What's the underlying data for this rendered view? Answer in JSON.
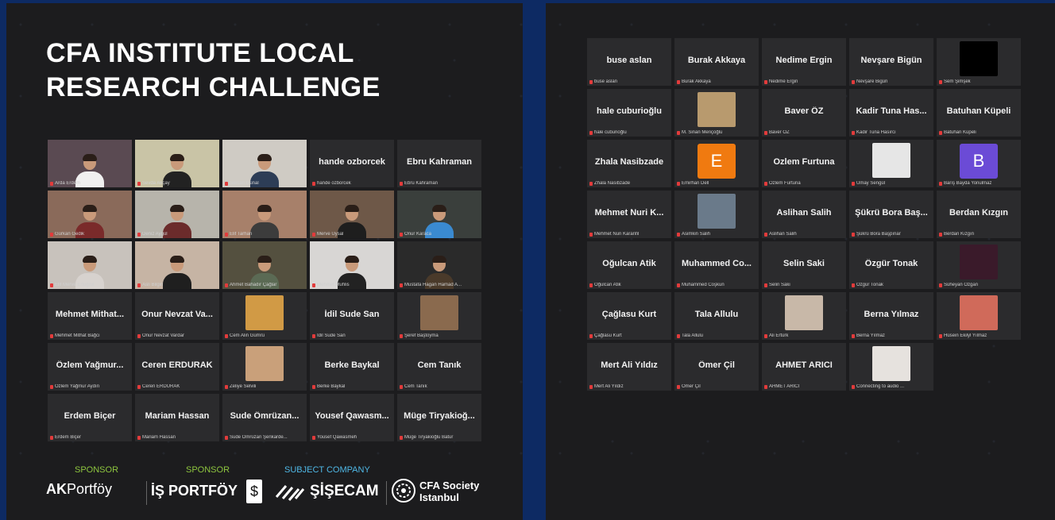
{
  "title_line1": "CFA INSTITUTE LOCAL",
  "title_line2": "RESEARCH CHALLENGE",
  "colors": {
    "background": "#0d2a63",
    "panel": "#1c1c1e",
    "tile": "#2b2b2d",
    "speaking": "#c7e16a",
    "sponsor": "#8ec63f",
    "subject": "#4fb8e6",
    "mic_muted": "#e23b3b"
  },
  "left_tiles": [
    {
      "type": "video",
      "small": "Arda Erdem",
      "bg": "#5a4a52",
      "shirt": "#f0f0f0"
    },
    {
      "type": "video",
      "small": "Sevda Akçay",
      "bg": "#c9c4a6",
      "shirt": "#222",
      "speaking": true
    },
    {
      "type": "video",
      "small": "Sercan Günal",
      "bg": "#cfcbc4",
      "shirt": "#2d3d56"
    },
    {
      "type": "name",
      "big": "hande ozborcek",
      "small": "hande ozborcek"
    },
    {
      "type": "name",
      "big": "Ebru Kahraman",
      "small": "Ebru Kahraman"
    },
    {
      "type": "video",
      "small": "Gürkan Gedik",
      "bg": "#8a6a5a",
      "shirt": "#7a2a2a"
    },
    {
      "type": "video",
      "small": "Deniz Aygül",
      "bg": "#b7b4ab",
      "shirt": "#6b2b2b"
    },
    {
      "type": "video",
      "small": "Elif Tarhan",
      "bg": "#a7806a",
      "shirt": "#3c3c3c"
    },
    {
      "type": "video",
      "small": "Merve Uysal",
      "bg": "#6e5848",
      "shirt": "#1e1e1e"
    },
    {
      "type": "video",
      "small": "Onur Karaca",
      "bg": "#3a3f3c",
      "shirt": "#3a8ad0"
    },
    {
      "type": "video",
      "small": "Elif Merve Ertuğrul",
      "bg": "#c8c2bc",
      "shirt": "#d7d2ce"
    },
    {
      "type": "video",
      "small": "Aslı Bilgin",
      "bg": "#c6b4a4",
      "shirt": "#1f1f1f"
    },
    {
      "type": "video",
      "small": "Ahmet Bahadır Çağlar",
      "bg": "#54503f",
      "shirt": "#5b6a54"
    },
    {
      "type": "video",
      "small": "Mehmet Muhlis",
      "bg": "#d8d6d4",
      "shirt": "#222"
    },
    {
      "type": "video",
      "small": "Mustafa Hagan Hamad A...",
      "bg": "#2a2a2a",
      "shirt": "#4a3a2a"
    },
    {
      "type": "name",
      "big": "Mehmet  Mithat...",
      "small": "Mehmet Mithat Bağcı"
    },
    {
      "type": "name",
      "big": "Onur Nevzat Va...",
      "small": "Onur Nevzat Vardar"
    },
    {
      "type": "thumb",
      "small": "Cem Alin Gümrü",
      "bg": "#d19a45"
    },
    {
      "type": "name",
      "big": "İdil Sude San",
      "small": "İdil Sude San"
    },
    {
      "type": "thumb",
      "small": "Şeref Baştoyma",
      "bg": "#8a6a4e"
    },
    {
      "type": "name",
      "big": "Özlem Yağmur...",
      "small": "Özlem Yağmur Aydın"
    },
    {
      "type": "name",
      "big": "Ceren ERDURAK",
      "small": "Ceren ERDURAK"
    },
    {
      "type": "thumb",
      "small": "Zeliye Selvili",
      "bg": "#c9a07a"
    },
    {
      "type": "name",
      "big": "Berke Baykal",
      "small": "Berke Baykal"
    },
    {
      "type": "name",
      "big": "Cem Tanık",
      "small": "Cem Tanık"
    },
    {
      "type": "name",
      "big": "Erdem Biçer",
      "small": "Erdem Biçer"
    },
    {
      "type": "name",
      "big": "Mariam Hassan",
      "small": "Mariam Hassan"
    },
    {
      "type": "name",
      "big": "Sude Ömrüzan...",
      "small": "Sude Ömrüzan Şenkarde..."
    },
    {
      "type": "name",
      "big": "Yousef Qawasm...",
      "small": "Yousef Qawasmeh"
    },
    {
      "type": "name",
      "big": "Müge Tiryakioğ...",
      "small": "Müge Tiryakioğlu Batur"
    }
  ],
  "right_tiles": [
    {
      "type": "name",
      "big": "buse aslan",
      "small": "buse aslan"
    },
    {
      "type": "name",
      "big": "Burak Akkaya",
      "small": "Burak Akkaya"
    },
    {
      "type": "name",
      "big": "Nedime Ergin",
      "small": "Nedime Ergin"
    },
    {
      "type": "name",
      "big": "Nevşare Bigün",
      "small": "Nevşare Bigün"
    },
    {
      "type": "thumb",
      "small": "Sem Şimşek",
      "bg": "#000000"
    },
    {
      "type": "name",
      "big": "hale cuburioğlu",
      "small": "hale cuburioğlu"
    },
    {
      "type": "thumb",
      "small": "M. Sinan Meriçoğlu",
      "bg": "#b89a6e"
    },
    {
      "type": "name",
      "big": "Baver ÖZ",
      "small": "Baver ÖZ"
    },
    {
      "type": "name",
      "big": "Kadir Tuna Has...",
      "small": "Kadir Tuna Hasırcı"
    },
    {
      "type": "name",
      "big": "Batuhan Küpeli",
      "small": "Batuhan Küpeli"
    },
    {
      "type": "name",
      "big": "Zhala Nasibzade",
      "small": "Zhala Nasibzade"
    },
    {
      "type": "avatar",
      "letter": "E",
      "small": "Emirhan Dell",
      "bg": "#f07a10"
    },
    {
      "type": "name",
      "big": "Ozlem Furtuna",
      "small": "Ozlem Furtuna"
    },
    {
      "type": "thumb",
      "small": "Umay Sengül",
      "bg": "#e6e6e6"
    },
    {
      "type": "avatar",
      "letter": "B",
      "small": "Barış Bayda Yonulmaz",
      "bg": "#6b4bd6"
    },
    {
      "type": "name",
      "big": "Mehmet Nuri K...",
      "small": "Mehmet Nuri Karanfil"
    },
    {
      "type": "thumb",
      "small": "Asimkin Salih",
      "bg": "#6a7a8a"
    },
    {
      "type": "name",
      "big": "Aslihan Salih",
      "small": "Aslihan Salih"
    },
    {
      "type": "name",
      "big": "Şükrü Bora Baş...",
      "small": "Şükrü Bora Başpınar"
    },
    {
      "type": "name",
      "big": "Berdan Kızgın",
      "small": "Berdan Kızgın"
    },
    {
      "type": "name",
      "big": "Oğulcan Atik",
      "small": "Oğulcan Atik"
    },
    {
      "type": "name",
      "big": "Muhammed  Co...",
      "small": "Muhammed Coşkun"
    },
    {
      "type": "name",
      "big": "Selin Saki",
      "small": "Selin Saki"
    },
    {
      "type": "name",
      "big": "Özgür Tonak",
      "small": "Özgür Tonak"
    },
    {
      "type": "thumb",
      "small": "Süheyan Özgan",
      "bg": "#3a1a2a"
    },
    {
      "type": "name",
      "big": "Çağlasu Kurt",
      "small": "Çağlasu Kurt"
    },
    {
      "type": "name",
      "big": "Tala Allulu",
      "small": "Tala Allulu"
    },
    {
      "type": "thumb",
      "small": "Ali Ertürk",
      "bg": "#c8b8a8"
    },
    {
      "type": "name",
      "big": "Berna Yılmaz",
      "small": "Berna Yılmaz"
    },
    {
      "type": "thumb",
      "small": "Hüsein Ekilyl Yılmaz",
      "bg": "#d06a5a"
    },
    {
      "type": "name",
      "big": "Mert Ali Yıldız",
      "small": "Mert Ali Yıldız"
    },
    {
      "type": "name",
      "big": "Ömer Çil",
      "small": "Ömer Çil"
    },
    {
      "type": "name",
      "big": "AHMET ARICI",
      "small": "AHMET ARICI"
    },
    {
      "type": "thumb",
      "small": "Connecting to audio ...",
      "bg": "#e6e2de"
    }
  ],
  "footer": {
    "sponsor1_label": "SPONSOR",
    "sponsor1_name_bold": "AK",
    "sponsor1_name_rest": "Portföy",
    "sponsor2_label": "SPONSOR",
    "sponsor2_name": "İŞ PORTFÖY",
    "subject_label": "SUBJECT COMPANY",
    "subject_name": "ŞİŞECAM",
    "society_line1": "CFA Society",
    "society_line2": "Istanbul"
  }
}
